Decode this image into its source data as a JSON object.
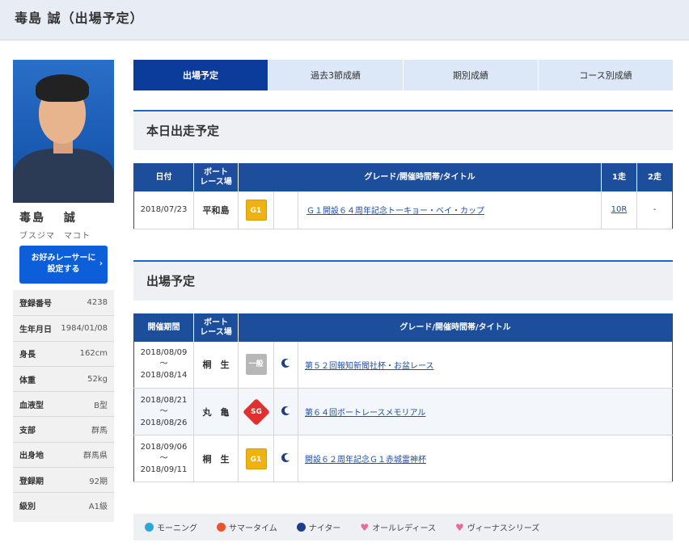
{
  "header": {
    "title": "毒島 誠（出場予定）"
  },
  "profile": {
    "name": "毒島　 誠",
    "kana": "ブスジマ　マコト",
    "fav_button": "お好みレーサーに設定する",
    "fav_line1": "お好みレーサーに",
    "fav_line2": "設定する",
    "rows": [
      {
        "key": "登録番号",
        "value": "4238"
      },
      {
        "key": "生年月日",
        "value": "1984/01/08"
      },
      {
        "key": "身長",
        "value": "162cm"
      },
      {
        "key": "体重",
        "value": "52kg"
      },
      {
        "key": "血液型",
        "value": "B型"
      },
      {
        "key": "支部",
        "value": "群馬"
      },
      {
        "key": "出身地",
        "value": "群馬県"
      },
      {
        "key": "登録期",
        "value": "92期"
      },
      {
        "key": "級別",
        "value": "A1級"
      }
    ]
  },
  "tabs": [
    "出場予定",
    "過去3節成績",
    "期別成績",
    "コース別成績"
  ],
  "today": {
    "title": "本日出走予定",
    "headers": {
      "date": "日付",
      "venue1": "ボート",
      "venue2": "レース場",
      "grade": "グレード/開催時間帯/タイトル",
      "r1": "1走",
      "r2": "2走"
    },
    "rows": [
      {
        "date": "2018/07/23",
        "venue": "平和島",
        "grade": "G1",
        "title": "Ｇ１開設６４周年記念トーキョー・ベイ・カップ",
        "r1": "10R",
        "r2": "-"
      }
    ]
  },
  "schedule": {
    "title": "出場予定",
    "headers": {
      "period": "開催期間",
      "venue1": "ボート",
      "venue2": "レース場",
      "grade": "グレード/開催時間帯/タイトル"
    },
    "rows": [
      {
        "start": "2018/08/09",
        "sep": "～",
        "end": "2018/08/14",
        "venue": "桐　生",
        "grade": "一般",
        "title": "第５２回報知新聞社杯・お盆レース"
      },
      {
        "start": "2018/08/21",
        "sep": "～",
        "end": "2018/08/26",
        "venue": "丸　亀",
        "grade": "SG",
        "title": "第６４回ボートレースメモリアル"
      },
      {
        "start": "2018/09/06",
        "sep": "～",
        "end": "2018/09/11",
        "venue": "桐　生",
        "grade": "G1",
        "title": "開設６２周年記念Ｇ１赤城雷神杯"
      }
    ]
  },
  "legend": [
    "モーニング",
    "サマータイム",
    "ナイター",
    "オールレディース",
    "ヴィーナスシリーズ"
  ]
}
